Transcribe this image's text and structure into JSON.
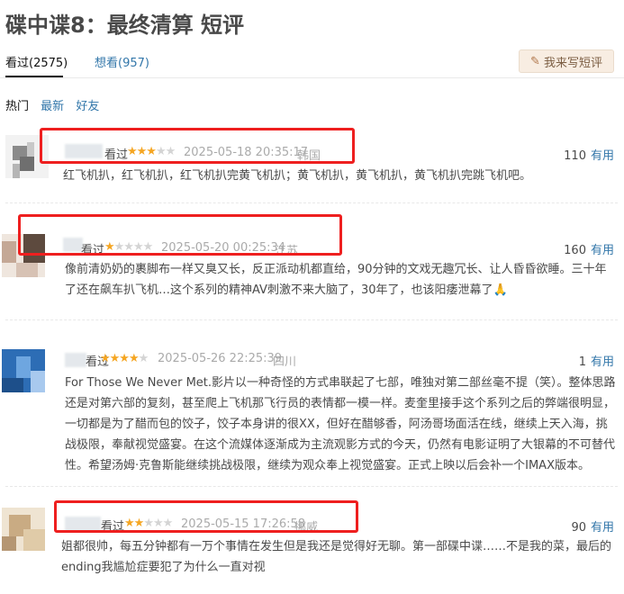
{
  "page": {
    "title": "碟中谍8：最终清算 短评",
    "tabs": [
      {
        "label": "看过(2575)"
      },
      {
        "label": "想看(957)"
      }
    ],
    "write_button": "我来写短评",
    "sorts": [
      "热门",
      "最新",
      "好友"
    ]
  },
  "comments": [
    {
      "status": "看过",
      "rating": 3,
      "datetime": "2025-05-18 20:35:17",
      "location": "韩国",
      "votes": "110",
      "vote_label": "有用",
      "lines": [
        "红飞机扒，红飞机扒，红飞机扒完黄飞机扒；黄飞机扒，黄飞机扒，黄飞机扒完跳飞机吧。"
      ]
    },
    {
      "status": "看过",
      "rating": 1,
      "datetime": "2025-05-20 00:25:34",
      "location": "江苏",
      "votes": "160",
      "vote_label": "有用",
      "lines": [
        "像前清奶奶的裹脚布一样又臭又长，反正派动机都直给，90分钟的文戏无趣冗长、让人昏昏欲睡。三十年",
        "了还在飙车扒飞机…这个系列的精神AV刺激不来大脑了，30年了，也该阳痿泄幕了"
      ],
      "emoji": "🙏"
    },
    {
      "status": "看过",
      "rating": 4,
      "datetime": "2025-05-26 22:25:39",
      "location": "四川",
      "votes": "1",
      "vote_label": "有用",
      "lines": [
        "For Those We Never Met.影片以一种奇怪的方式串联起了七部，唯独对第二部丝毫不提（笑）。整体思路",
        "还是对第六部的复刻，甚至爬上飞机那飞行员的表情都一模一样。麦奎里接手这个系列之后的弊端很明显，",
        "一切都是为了醋而包的饺子，饺子本身讲的很XX，但好在醋够香，阿汤哥场面活在线，继续上天入海，挑",
        "战极限，奉献视觉盛宴。在这个流媒体逐渐成为主流观影方式的今天，仍然有电影证明了大银幕的不可替代",
        "性。希望汤姆·克鲁斯能继续挑战极限，继续为观众奉上视觉盛宴。正式上映以后会补一个IMAX版本。"
      ]
    },
    {
      "status": "看过",
      "rating": 2,
      "datetime": "2025-05-15 17:26:58",
      "location": "挪威",
      "votes": "90",
      "vote_label": "有用",
      "lines": [
        "姐都很帅，每五分钟都有一万个事情在发生但是我还是觉得好无聊。第一部碟中谍……不是我的菜，最后的",
        "ending我尴尬症要犯了为什么一直对视"
      ]
    }
  ],
  "colors": {
    "link": "#3377aa",
    "star": "#f5a623",
    "highlight_box": "#ee1f1f"
  }
}
